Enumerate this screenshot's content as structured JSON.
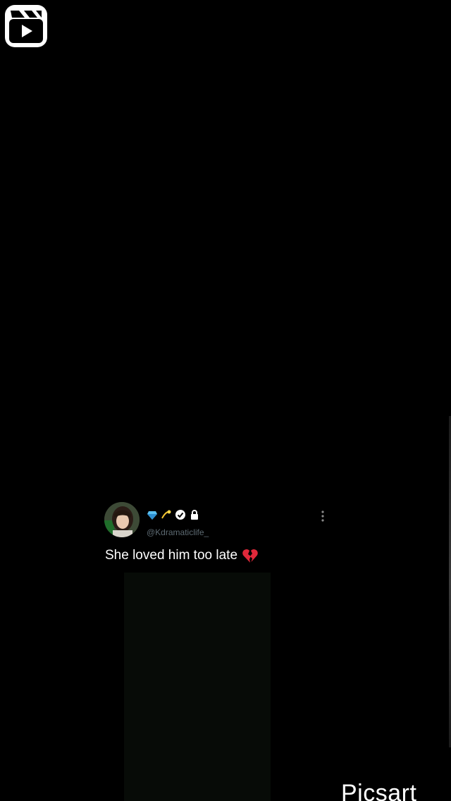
{
  "post": {
    "handle": "@Kdramaticlife_",
    "text": "She loved him too late",
    "badge_icons": [
      "gem-icon",
      "dizzy-icon",
      "verified-icon",
      "lock-icon"
    ],
    "reaction_icon": "broken-heart-icon"
  },
  "watermark": {
    "text": "Picsart"
  },
  "colors": {
    "background": "#000000",
    "text": "#ffffff",
    "handle": "#5d6a72",
    "media_panel": "#070b07"
  }
}
